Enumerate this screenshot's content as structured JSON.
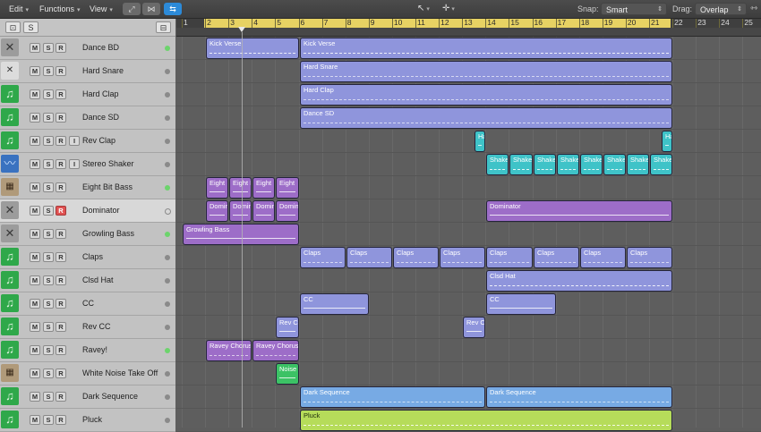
{
  "menu": {
    "edit": "Edit",
    "functions": "Functions",
    "view": "View",
    "snap_label": "Snap:",
    "snap_value": "Smart",
    "drag_label": "Drag:",
    "drag_value": "Overlap"
  },
  "header": {
    "s_label": "S"
  },
  "ruler": {
    "bars": [
      "1",
      "2",
      "3",
      "4",
      "5",
      "6",
      "7",
      "8",
      "9",
      "10",
      "11",
      "12",
      "13",
      "14",
      "15",
      "16",
      "17",
      "18",
      "19",
      "20",
      "21",
      "22",
      "23",
      "24",
      "25"
    ]
  },
  "tracks": [
    {
      "name": "Dance BD",
      "m": "M",
      "s": "S",
      "r": "R",
      "icon": "drum-machine-icon"
    },
    {
      "name": "Hard Snare",
      "m": "M",
      "s": "S",
      "r": "R",
      "icon": "drum-machine-icon"
    },
    {
      "name": "Hard Clap",
      "m": "M",
      "s": "S",
      "r": "R",
      "icon": "music-note-icon"
    },
    {
      "name": "Dance SD",
      "m": "M",
      "s": "S",
      "r": "R",
      "icon": "music-note-icon"
    },
    {
      "name": "Rev Clap",
      "m": "M",
      "s": "S",
      "r": "R",
      "i": "I",
      "icon": "music-note-icon"
    },
    {
      "name": "Stereo Shaker",
      "m": "M",
      "s": "S",
      "r": "R",
      "i": "I",
      "icon": "audio-waveform-icon"
    },
    {
      "name": "Eight Bit Bass",
      "m": "M",
      "s": "S",
      "r": "R",
      "icon": "synth-keyboard-icon"
    },
    {
      "name": "Dominator",
      "m": "M",
      "s": "S",
      "r": "R",
      "icon": "drum-machine-icon"
    },
    {
      "name": "Growling Bass",
      "m": "M",
      "s": "S",
      "r": "R",
      "icon": "drum-machine-icon"
    },
    {
      "name": "Claps",
      "m": "M",
      "s": "S",
      "r": "R",
      "icon": "music-note-icon"
    },
    {
      "name": "Clsd Hat",
      "m": "M",
      "s": "S",
      "r": "R",
      "icon": "music-note-icon"
    },
    {
      "name": "CC",
      "m": "M",
      "s": "S",
      "r": "R",
      "icon": "music-note-icon"
    },
    {
      "name": "Rev CC",
      "m": "M",
      "s": "S",
      "r": "R",
      "icon": "music-note-icon"
    },
    {
      "name": "Ravey!",
      "m": "M",
      "s": "S",
      "r": "R",
      "icon": "music-note-icon"
    },
    {
      "name": "White Noise Take Off",
      "m": "M",
      "s": "S",
      "r": "R",
      "icon": "synth-keyboard-icon"
    },
    {
      "name": "Dark Sequence",
      "m": "M",
      "s": "S",
      "r": "R",
      "icon": "music-note-icon"
    },
    {
      "name": "Pluck",
      "m": "M",
      "s": "S",
      "r": "R",
      "icon": "music-note-icon"
    }
  ],
  "regions": {
    "kick_verse": "Kick Verse",
    "hard_snare": "Hard Snare",
    "hard_clap": "Hard Clap",
    "dance_sd": "Dance SD",
    "ha": "Ha",
    "shaker": "Shaker",
    "eight": "Eight",
    "eight_b": "Eight B",
    "domin": "Domin",
    "dominator": "Dominator",
    "growling_bass": "Growling Bass",
    "claps": "Claps",
    "clsd_hat": "Clsd Hat",
    "cc": "CC",
    "rev_c": "Rev C",
    "ravey_chorus": "Ravey Chorus",
    "noise": "Noise",
    "dark_sequence": "Dark Sequence",
    "pluck": "Pluck"
  },
  "colors": {
    "periwinkle": "#8f95dc",
    "purple": "#9d6dc8",
    "cyan": "#3fc3c8",
    "green": "#3cc265",
    "blue": "#77aae4",
    "lime": "#b6dc5a",
    "cycle": "#e7d263"
  }
}
